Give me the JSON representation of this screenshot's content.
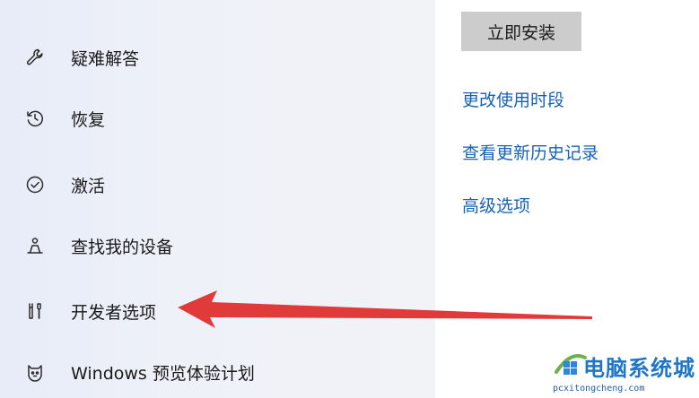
{
  "sidebar": {
    "items": [
      {
        "label": "疑难解答",
        "icon": "wrench-icon"
      },
      {
        "label": "恢复",
        "icon": "history-icon"
      },
      {
        "label": "激活",
        "icon": "check-circle-icon"
      },
      {
        "label": "查找我的设备",
        "icon": "person-location-icon"
      },
      {
        "label": "开发者选项",
        "icon": "developer-tools-icon"
      },
      {
        "label": "Windows 预览体验计划",
        "icon": "insider-cat-icon"
      }
    ]
  },
  "main": {
    "install_button": "立即安装",
    "links": [
      "更改使用时段",
      "查看更新历史记录",
      "高级选项"
    ]
  },
  "watermark": {
    "title": "电脑系统城",
    "url": "pcxitongcheng.com"
  },
  "colors": {
    "link": "#1762b5",
    "arrow": "#e03a3a",
    "button_bg": "#cccccc",
    "sidebar_bg": "#eef1f8"
  }
}
